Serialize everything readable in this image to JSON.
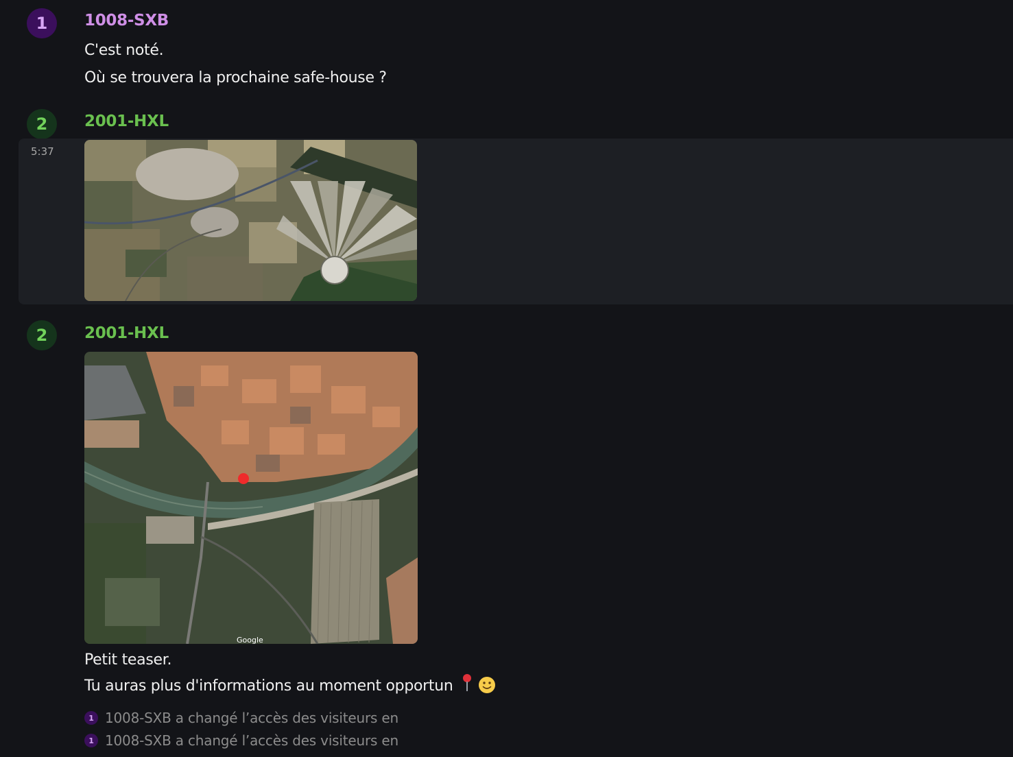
{
  "messages": [
    {
      "avatar": "1",
      "sender": "1008-SXB",
      "color": "#cf8fe6",
      "lines": [
        "C'est noté.",
        "Où se trouvera la prochaine safe-house ?"
      ]
    },
    {
      "avatar": "2",
      "sender": "2001-HXL",
      "color": "#6ac04f",
      "timestamp": "5:37",
      "attachment": "aerial-map-image"
    },
    {
      "avatar": "2",
      "sender": "2001-HXL",
      "color": "#6ac04f",
      "attachment": "aerial-map-closeup-image",
      "map_watermark": "Google",
      "lines": [
        "Petit teaser.",
        "Tu auras plus d'informations au moment opportun"
      ],
      "emoji": [
        "round-pushpin-icon",
        "slightly-smiling-face-icon"
      ]
    }
  ],
  "notices": [
    {
      "avatar": "1",
      "text": "1008-SXB a changé l’accès des visiteurs en"
    },
    {
      "avatar": "1",
      "text": "1008-SXB a changé l’accès des visiteurs en"
    }
  ]
}
